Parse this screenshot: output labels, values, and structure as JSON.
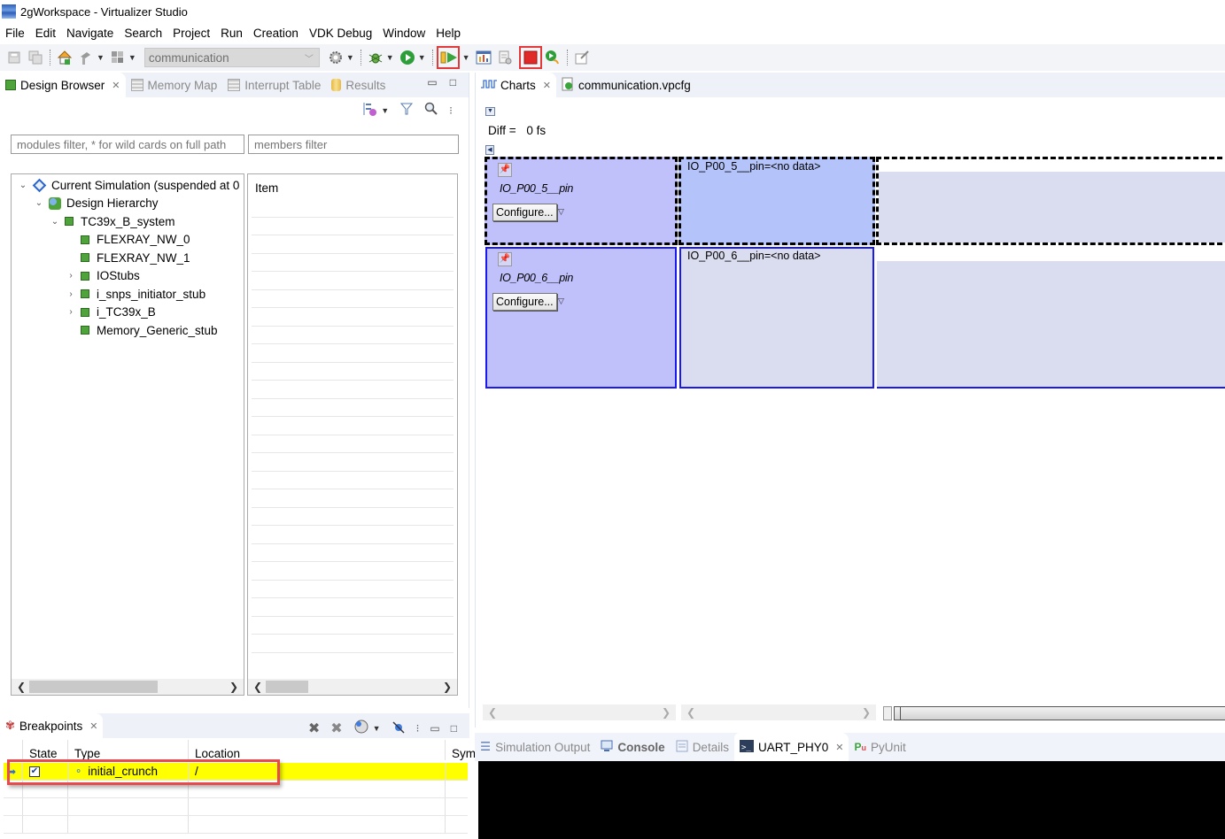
{
  "window": {
    "title": "2gWorkspace - Virtualizer Studio"
  },
  "menu": [
    "File",
    "Edit",
    "Navigate",
    "Search",
    "Project",
    "Run",
    "Creation",
    "VDK Debug",
    "Window",
    "Help"
  ],
  "toolbar": {
    "launch_config": "communication",
    "icons": [
      "save-icon",
      "save-all-icon",
      "home-build-icon",
      "hammer-icon",
      "module-icon",
      "settings-gear-icon",
      "debug-bug-icon",
      "run-icon",
      "resume-icon",
      "chart-icon",
      "script-icon",
      "stop-icon",
      "run-link-icon",
      "edit-icon"
    ]
  },
  "left_panel": {
    "tabs": [
      {
        "label": "Design Browser",
        "active": true
      },
      {
        "label": "Memory Map",
        "active": false
      },
      {
        "label": "Interrupt Table",
        "active": false
      },
      {
        "label": "Results",
        "active": false
      }
    ],
    "modules_filter_placeholder": "modules filter, * for wild cards on full path",
    "members_filter_placeholder": "members filter",
    "tree": [
      {
        "label": "Current Simulation (suspended at 0",
        "level": 0,
        "expander": "expanded",
        "icon": "diamond"
      },
      {
        "label": "Design Hierarchy",
        "level": 1,
        "expander": "expanded",
        "icon": "hierarchy"
      },
      {
        "label": "TC39x_B_system",
        "level": 2,
        "expander": "expanded",
        "icon": "chip"
      },
      {
        "label": "FLEXRAY_NW_0",
        "level": 3,
        "expander": "none",
        "icon": "chip"
      },
      {
        "label": "FLEXRAY_NW_1",
        "level": 3,
        "expander": "none",
        "icon": "chip"
      },
      {
        "label": "IOStubs",
        "level": 3,
        "expander": "collapsed",
        "icon": "chip"
      },
      {
        "label": "i_snps_initiator_stub",
        "level": 3,
        "expander": "collapsed",
        "icon": "chip"
      },
      {
        "label": "i_TC39x_B",
        "level": 3,
        "expander": "collapsed",
        "icon": "chip"
      },
      {
        "label": "Memory_Generic_stub",
        "level": 3,
        "expander": "none",
        "icon": "chip"
      }
    ],
    "members_header": "Item"
  },
  "breakpoints": {
    "title": "Breakpoints",
    "columns": [
      "",
      "State",
      "Type",
      "Location",
      "Sym"
    ],
    "rows": [
      {
        "state_checked": true,
        "type": "initial_crunch",
        "location": "/",
        "selected": true
      }
    ]
  },
  "charts": {
    "tabs": [
      {
        "label": "Charts",
        "active": true
      },
      {
        "label": "communication.vpcfg",
        "active": false
      }
    ],
    "diff_label": "Diff =",
    "diff_value": "0 fs",
    "signals": [
      {
        "name": "IO_P00_5__pin",
        "value_text": "IO_P00_5__pin=<no data>",
        "configure_label": "Configure...",
        "selected": true
      },
      {
        "name": "IO_P00_6__pin",
        "value_text": "IO_P00_6__pin=<no data>",
        "configure_label": "Configure...",
        "selected": false
      }
    ]
  },
  "bottom_panel": {
    "tabs": [
      {
        "label": "Simulation Output",
        "active": false
      },
      {
        "label": "Console",
        "active": false
      },
      {
        "label": "Details",
        "active": false
      },
      {
        "label": "UART_PHY0",
        "active": true
      },
      {
        "label": "PyUnit",
        "active": false
      }
    ]
  },
  "colors": {
    "highlight_red": "#e23a3a",
    "selected_row": "#ffff00",
    "signal_name_bg": "#c0c0fb",
    "signal_value_selected_bg": "#b4c4fa",
    "signal_value_bg": "#dadcef",
    "signal_border": "#1a1aee"
  }
}
